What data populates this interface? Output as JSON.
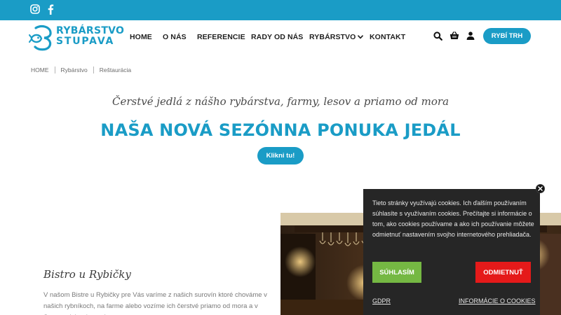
{
  "topbar": {
    "icons": [
      "instagram-icon",
      "facebook-icon"
    ],
    "color": "#1a9cc6"
  },
  "logo": {
    "line1": "RYBÁRSTVO",
    "line2": "STUPAVA",
    "color": "#1a9cc6"
  },
  "nav": {
    "home": "HOME",
    "about": "O NÁS",
    "references": "REFERENCIE",
    "advice": "RADY OD NÁS",
    "fishery": "RYBÁRSTVO",
    "contact": "KONTAKT"
  },
  "tools": {
    "icons": [
      "search-icon",
      "basket-icon",
      "user-icon"
    ]
  },
  "market_button": "RYBÍ TRH",
  "breadcrumb": {
    "items": [
      "HOME",
      "Rybárstvo",
      "Reštaurácia"
    ]
  },
  "hero": {
    "tagline": "Čerstvé jedlá z nášho rybárstva, farmy, lesov a priamo od mora",
    "title": "NAŠA NOVÁ SEZÓNNA PONUKA JEDÁL",
    "cta": "Klikni tu!"
  },
  "bistro": {
    "title": "Bistro u Rybičky",
    "text": "V našom Bistre u Rybičky pre Vás varíme z našich surovín ktoré chováme v našich rybníkoch, na farme alebo vozíme ich čerstvé priamo od mora a v Stupave ich pripravujeme."
  },
  "cookie": {
    "text": "Tieto stránky využívajú cookies. Ich ďalším používaním súhlasíte s využívaním cookies. Prečítajte si informácie o tom, ako cookies používame a ako ich používanie môžete odmietnuť nastavením svojho internetového prehliadača.",
    "agree": "SÚHLASÍM",
    "reject": "ODMIETNUŤ",
    "gdpr": "GDPR",
    "info": "INFORMÁCIE O COOKIES",
    "colors": {
      "agree": "#75b843",
      "reject": "#e51a1a",
      "background": "#262626"
    }
  }
}
